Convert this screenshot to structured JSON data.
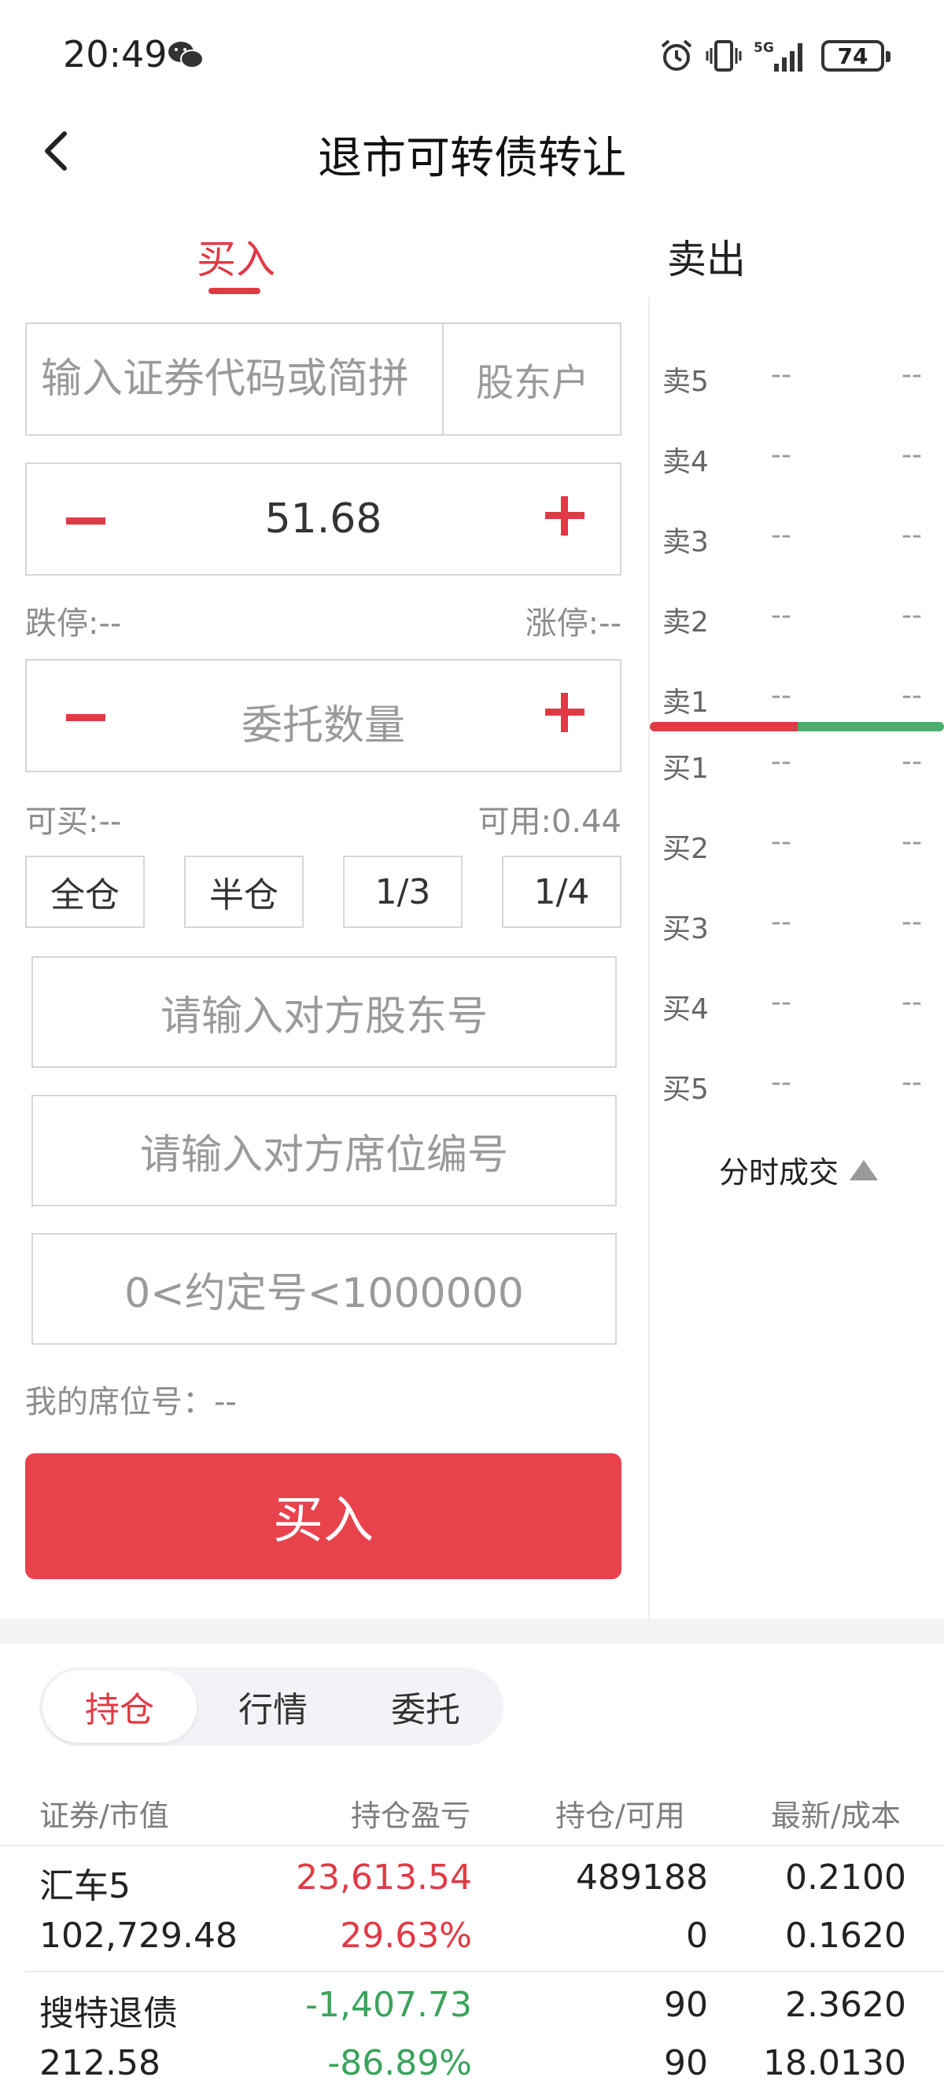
{
  "status_bar": {
    "time": "20:49",
    "network": "5G",
    "battery": "74",
    "icons": [
      "wechat-icon",
      "alarm-icon",
      "vibrate-icon",
      "signal-icon",
      "battery-icon"
    ]
  },
  "header": {
    "title": "退市可转债转让",
    "back_icon": "chevron-left-icon"
  },
  "trade_tabs": {
    "buy": "买入",
    "sell": "卖出",
    "active": "buy"
  },
  "form": {
    "code_placeholder": "输入证券代码或简拼",
    "holder_account": "股东户",
    "price": "51.68",
    "limit_down": "跌停:--",
    "limit_up": "涨停:--",
    "quantity_placeholder": "委托数量",
    "can_buy": "可买:--",
    "available": "可用:0.44",
    "ratios": [
      "全仓",
      "半仓",
      "1/3",
      "1/4"
    ],
    "counterparty_holder_placeholder": "请输入对方股东号",
    "counterparty_seat_placeholder": "请输入对方席位编号",
    "agreement_no_placeholder": "0<约定号<1000000",
    "my_seat": "我的席位号：--",
    "submit": "买入"
  },
  "order_book": {
    "sell": [
      {
        "label": "卖5",
        "price": "--",
        "volume": "--"
      },
      {
        "label": "卖4",
        "price": "--",
        "volume": "--"
      },
      {
        "label": "卖3",
        "price": "--",
        "volume": "--"
      },
      {
        "label": "卖2",
        "price": "--",
        "volume": "--"
      },
      {
        "label": "卖1",
        "price": "--",
        "volume": "--"
      }
    ],
    "buy": [
      {
        "label": "买1",
        "price": "--",
        "volume": "--"
      },
      {
        "label": "买2",
        "price": "--",
        "volume": "--"
      },
      {
        "label": "买3",
        "price": "--",
        "volume": "--"
      },
      {
        "label": "买4",
        "price": "--",
        "volume": "--"
      },
      {
        "label": "买5",
        "price": "--",
        "volume": "--"
      }
    ],
    "ticks_toggle": "分时成交",
    "colors": {
      "sell": "#e03a45",
      "buy": "#4aae6c"
    }
  },
  "bottom_tabs": {
    "items": [
      "持仓",
      "行情",
      "委托"
    ],
    "active": "持仓"
  },
  "holdings": {
    "headers": [
      "证券/市值",
      "持仓盈亏",
      "持仓/可用",
      "最新/成本"
    ],
    "rows": [
      {
        "name": "汇车5",
        "market_value": "102,729.48",
        "pnl": "23,613.54",
        "pnl_pct": "29.63%",
        "position": "489188",
        "available": "0",
        "latest": "0.2100",
        "cost": "0.1620",
        "trend": "up"
      },
      {
        "name": "搜特退债",
        "market_value": "212.58",
        "pnl": "-1,407.73",
        "pnl_pct": "-86.89%",
        "position": "90",
        "available": "90",
        "latest": "2.3620",
        "cost": "18.0130",
        "trend": "down"
      }
    ]
  }
}
